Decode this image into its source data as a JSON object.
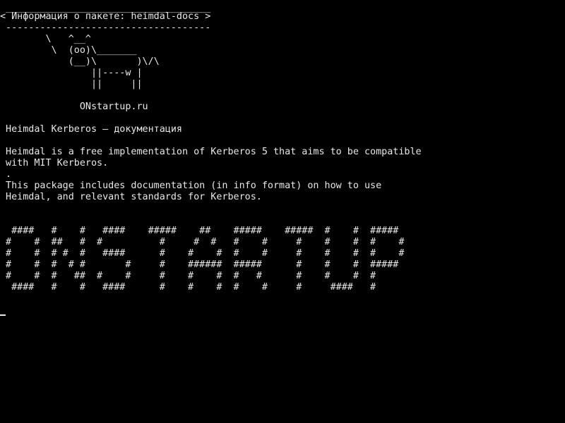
{
  "terminal": {
    "cowsay": {
      "border_top": " ____________________________________",
      "message": "< Информация о пакете: heimdal-docs >",
      "border_bottom": " ------------------------------------",
      "cow": [
        "        \\   ^__^",
        "         \\  (oo)\\_______",
        "            (__)\\       )\\/\\",
        "                ||----w |",
        "                ||     ||"
      ]
    },
    "site": "              ONstartup.ru",
    "title": " Heimdal Kerberos — документация",
    "description": [
      " Heimdal is a free implementation of Kerberos 5 that aims to be compatible",
      " with MIT Kerberos.",
      " .",
      " This package includes documentation (in info format) on how to use",
      " Heimdal, and relevant standards for Kerberos."
    ],
    "banner": [
      "  ####   #    #   ####    #####    ##    #####    #####  #    #  #####",
      " #    #  ##   #  #          #     #  #   #    #     #    #    #  #    #",
      " #    #  # #  #   ####      #    #    #  #    #     #    #    #  #    #",
      " #    #  #  # #       #     #    ######  #####      #    #    #  #####",
      " #    #  #   ##  #    #     #    #    #  #   #      #    #    #  #",
      "  ####   #    #   ####      #    #    #  #    #     #     ####   #"
    ]
  }
}
